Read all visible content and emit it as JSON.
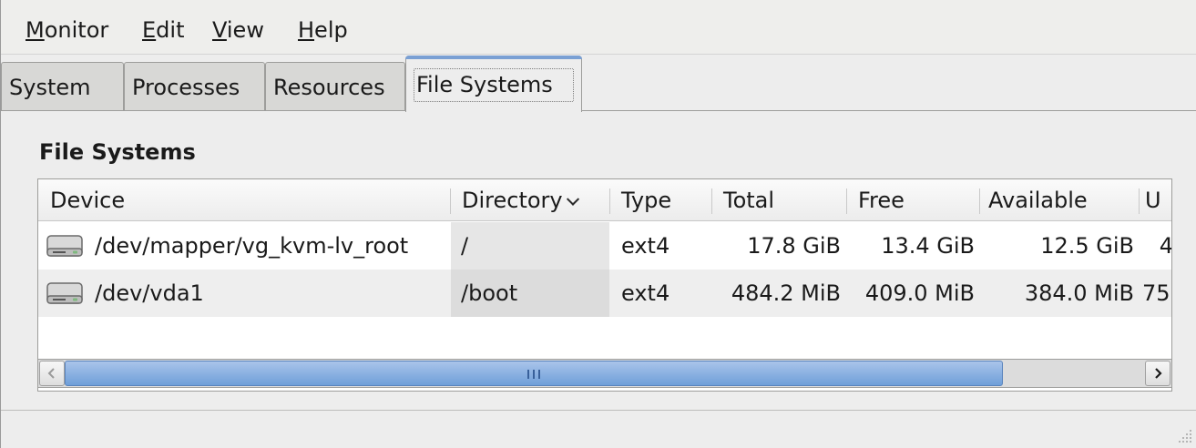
{
  "menubar": {
    "items": [
      {
        "label": "Monitor",
        "mnemonic": "M",
        "rest": "onitor"
      },
      {
        "label": "Edit",
        "mnemonic": "E",
        "rest": "dit"
      },
      {
        "label": "View",
        "mnemonic": "V",
        "rest": "iew"
      },
      {
        "label": "Help",
        "mnemonic": "H",
        "rest": "elp"
      }
    ]
  },
  "tabs": {
    "items": [
      {
        "label": "System"
      },
      {
        "label": "Processes"
      },
      {
        "label": "Resources"
      },
      {
        "label": "File Systems",
        "active": true
      }
    ]
  },
  "page": {
    "title": "File Systems"
  },
  "table": {
    "columns": [
      "Device",
      "Directory",
      "Type",
      "Total",
      "Free",
      "Available",
      "U"
    ],
    "sorted_column": "Directory",
    "rows": [
      {
        "icon": "hard-drive-icon",
        "device": "/dev/mapper/vg_kvm-lv_root",
        "directory": "/",
        "type": "ext4",
        "total": "17.8 GiB",
        "free": "13.4 GiB",
        "available": "12.5 GiB",
        "used": "4"
      },
      {
        "icon": "hard-drive-icon",
        "device": "/dev/vda1",
        "directory": "/boot",
        "type": "ext4",
        "total": "484.2 MiB",
        "free": "409.0 MiB",
        "available": "384.0 MiB",
        "used": "75"
      }
    ]
  },
  "colors": {
    "tab_active_accent": "#7aa0d4",
    "scroll_thumb": "#6f9fd9",
    "window_bg": "#ededed"
  }
}
